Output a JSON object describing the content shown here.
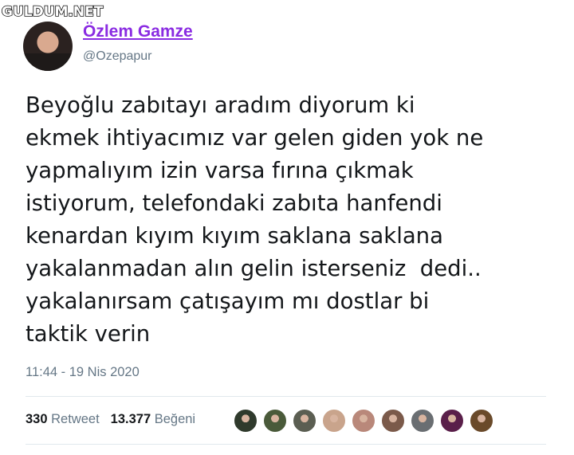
{
  "watermark": "GULDUM.NET",
  "user": {
    "display_name": "Özlem Gamze",
    "handle": "@Ozepapur",
    "avatar_icon": "profile-photo"
  },
  "tweet": {
    "lines": [
      "Beyoğlu zabıtayı aradım diyorum ki",
      "ekmek ihtiyacımız var gelen giden yok ne",
      "yapmalıyım izin varsa fırına çıkmak",
      "istiyorum, telefondaki zabıta hanfendi",
      "kenardan kıyım kıyım saklana saklana",
      "yakalanmadan alın gelin isterseniz  dedi..",
      "yakalanırsam çatışayım mı dostlar bi",
      "taktik verin"
    ],
    "timestamp": "11:44 - 19 Nis 2020"
  },
  "stats": {
    "retweets_count": "330",
    "retweets_label": "Retweet",
    "likes_count": "13.377",
    "likes_label": "Beğeni"
  },
  "likers": [
    {
      "color": "#2f3a2c"
    },
    {
      "color": "#4a5a3a"
    },
    {
      "color": "#5b5e52"
    },
    {
      "color": "#c9a48c"
    },
    {
      "color": "#b9887a"
    },
    {
      "color": "#7b5a4a"
    },
    {
      "color": "#6a6e72"
    },
    {
      "color": "#5a1f4a"
    },
    {
      "color": "#6a4a2a"
    }
  ]
}
